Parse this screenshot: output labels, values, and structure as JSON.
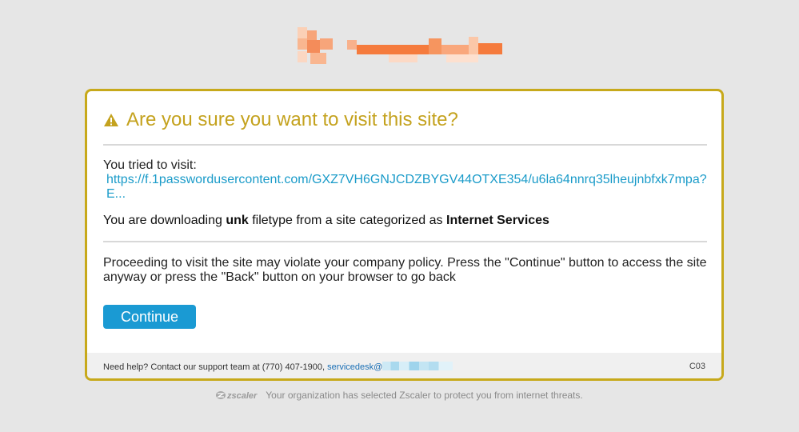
{
  "logo": {
    "semantic": "pixelated-brand-logo",
    "colors": [
      "#f7a57a",
      "#f48c5a",
      "#fbc7a8",
      "#f57b3d",
      "#f9b690"
    ]
  },
  "warning": {
    "icon": "warning-triangle-icon",
    "title": "Are you sure you want to visit this site?",
    "title_color": "#c4a21e",
    "border_color": "#c7a91b"
  },
  "visit": {
    "label": "You tried to visit:",
    "url": "https://f.1passwordusercontent.com/GXZ7VH6GNJCDZBYGV44OTXE354/u6la64nnrq35lheujnbfxk7mpa?E..."
  },
  "download": {
    "prefix": "You are downloading ",
    "filetype": "unk",
    "middle": " filetype from a site categorized as ",
    "category": "Internet Services"
  },
  "policy": {
    "text": "Proceeding to visit the site may violate your company policy. Press the \"Continue\" button to access the site anyway or press the \"Back\" button on your browser to go back"
  },
  "actions": {
    "continue_label": "Continue",
    "button_color": "#1a9ad3"
  },
  "footer": {
    "help_text": "Need help? Contact our support team at (770) 407-1900, ",
    "email_prefix": "servicedesk@",
    "code": "C03"
  },
  "bottom": {
    "brand": "zscaler",
    "text": "Your organization has selected Zscaler to protect you from internet threats."
  }
}
